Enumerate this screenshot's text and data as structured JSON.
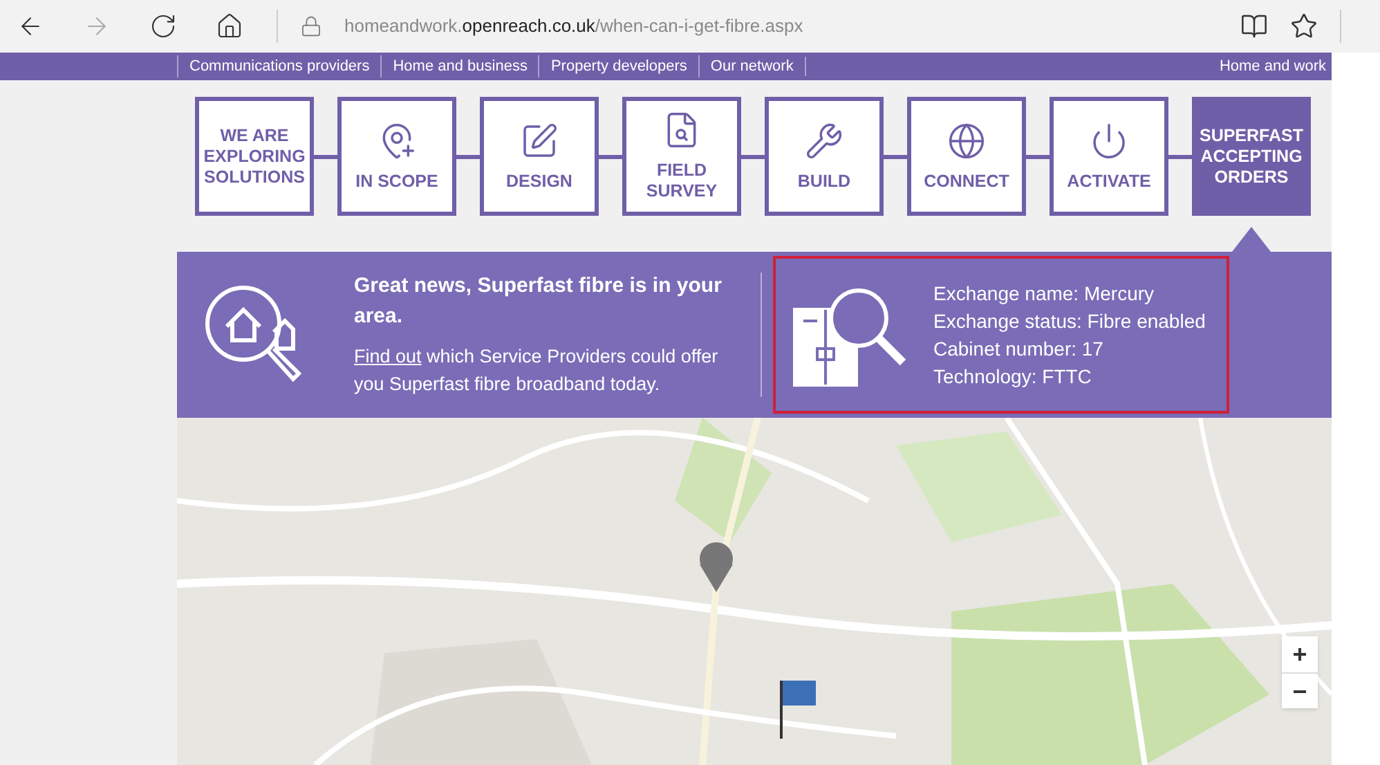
{
  "browser": {
    "url_host": "homeandwork.",
    "url_domain": "openreach.co.uk",
    "url_path": "/when-can-i-get-fibre.aspx"
  },
  "nav": {
    "links": [
      "Communications providers",
      "Home and business",
      "Property developers",
      "Our network"
    ],
    "right": "Home and work"
  },
  "steps": [
    {
      "label": "WE ARE EXPLORING SOLUTIONS",
      "selected": false
    },
    {
      "label": "IN SCOPE",
      "selected": false
    },
    {
      "label": "DESIGN",
      "selected": false
    },
    {
      "label": "FIELD SURVEY",
      "selected": false
    },
    {
      "label": "BUILD",
      "selected": false
    },
    {
      "label": "CONNECT",
      "selected": false
    },
    {
      "label": "ACTIVATE",
      "selected": false
    },
    {
      "label": "SUPERFAST ACCEPTING ORDERS",
      "selected": true
    }
  ],
  "result": {
    "headline": "Great news, Superfast fibre is in your area.",
    "link": "Find out",
    "text": " which Service Providers could offer you Superfast fibre broadband today.",
    "details": [
      "Exchange name: Mercury",
      "Exchange status: Fibre enabled",
      "Cabinet number: 17",
      "Technology: FTTC"
    ]
  },
  "map": {
    "zoom_in": "+",
    "zoom_out": "−"
  }
}
